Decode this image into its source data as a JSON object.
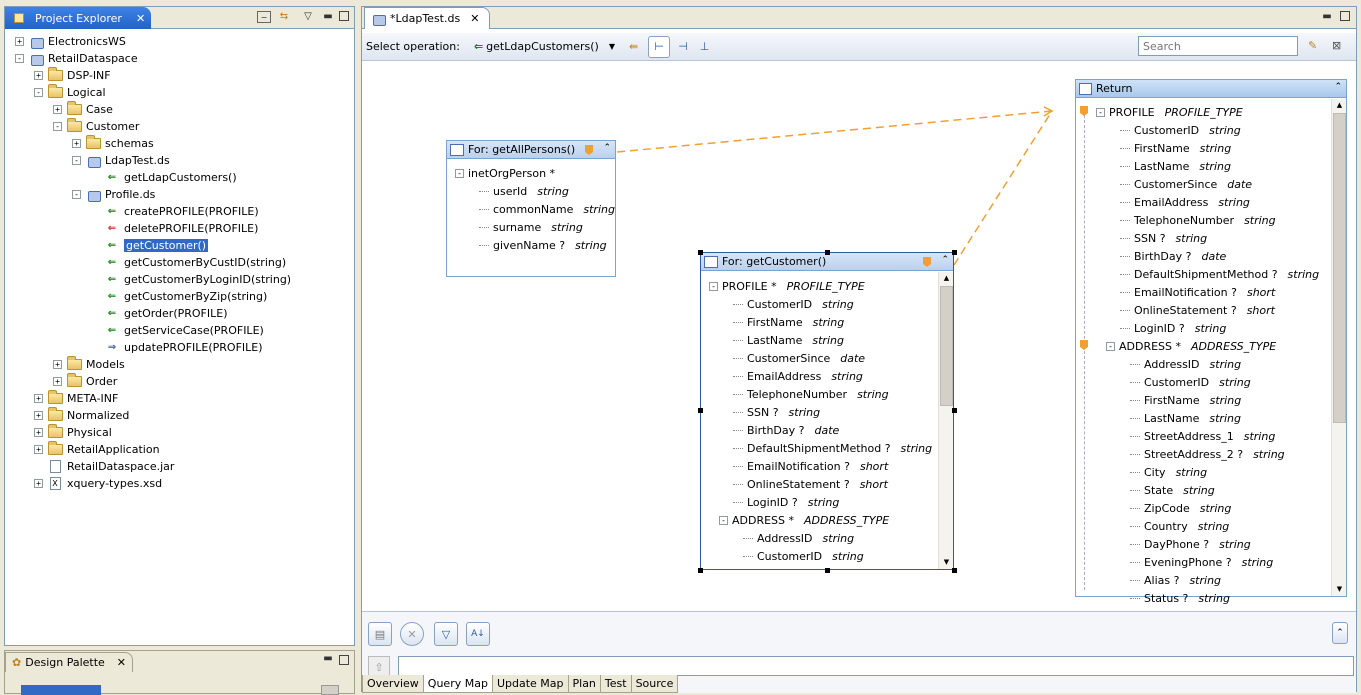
{
  "project_explorer": {
    "tab_label": "Project Explorer",
    "tree": [
      {
        "label": "ElectronicsWS",
        "kind": "ds-project",
        "expander": "+",
        "depth": 0
      },
      {
        "label": "RetailDataspace",
        "kind": "ds-project",
        "expander": "-",
        "depth": 0
      },
      {
        "label": "DSP-INF",
        "kind": "folder",
        "expander": "+",
        "depth": 1
      },
      {
        "label": "Logical",
        "kind": "folder",
        "expander": "-",
        "depth": 1
      },
      {
        "label": "Case",
        "kind": "folder",
        "expander": "+",
        "depth": 2
      },
      {
        "label": "Customer",
        "kind": "folder",
        "expander": "-",
        "depth": 2
      },
      {
        "label": "schemas",
        "kind": "folder",
        "expander": "+",
        "depth": 3
      },
      {
        "label": "LdapTest.ds",
        "kind": "ds",
        "expander": "-",
        "depth": 3
      },
      {
        "label": "getLdapCustomers()",
        "kind": "op",
        "expander": "",
        "depth": 4
      },
      {
        "label": "Profile.ds",
        "kind": "ds",
        "expander": "-",
        "depth": 3
      },
      {
        "label": "createPROFILE(PROFILE)",
        "kind": "op-create",
        "expander": "",
        "depth": 4
      },
      {
        "label": "deletePROFILE(PROFILE)",
        "kind": "op-delete",
        "expander": "",
        "depth": 4
      },
      {
        "label": "getCustomer()",
        "kind": "op",
        "expander": "",
        "depth": 4,
        "selected": true
      },
      {
        "label": "getCustomerByCustID(string)",
        "kind": "op",
        "expander": "",
        "depth": 4
      },
      {
        "label": "getCustomerByLoginID(string)",
        "kind": "op",
        "expander": "",
        "depth": 4
      },
      {
        "label": "getCustomerByZip(string)",
        "kind": "op",
        "expander": "",
        "depth": 4
      },
      {
        "label": "getOrder(PROFILE)",
        "kind": "op-nav",
        "expander": "",
        "depth": 4
      },
      {
        "label": "getServiceCase(PROFILE)",
        "kind": "op-nav",
        "expander": "",
        "depth": 4
      },
      {
        "label": "updatePROFILE(PROFILE)",
        "kind": "op-update",
        "expander": "",
        "depth": 4
      },
      {
        "label": "Models",
        "kind": "folder",
        "expander": "+",
        "depth": 2
      },
      {
        "label": "Order",
        "kind": "folder",
        "expander": "+",
        "depth": 2
      },
      {
        "label": "META-INF",
        "kind": "folder",
        "expander": "+",
        "depth": 1
      },
      {
        "label": "Normalized",
        "kind": "folder",
        "expander": "+",
        "depth": 1
      },
      {
        "label": "Physical",
        "kind": "folder",
        "expander": "+",
        "depth": 1
      },
      {
        "label": "RetailApplication",
        "kind": "folder",
        "expander": "+",
        "depth": 1
      },
      {
        "label": "RetailDataspace.jar",
        "kind": "file",
        "expander": "",
        "depth": 1
      },
      {
        "label": "xquery-types.xsd",
        "kind": "xsd",
        "expander": "+",
        "depth": 1
      }
    ]
  },
  "design_palette": {
    "tab_label": "Design Palette"
  },
  "editor": {
    "tab_label": "*LdapTest.ds",
    "toolbar": {
      "select_label": "Select operation:",
      "operation": "getLdapCustomers()",
      "search_placeholder": "Search"
    },
    "boxes": {
      "all_persons": {
        "title": "For: getAllPersons()",
        "rows": [
          {
            "name": "inetOrgPerson *",
            "type": "",
            "level": 0,
            "expander": "-"
          },
          {
            "name": "userId",
            "type": "string",
            "level": 1
          },
          {
            "name": "commonName",
            "type": "string",
            "level": 1
          },
          {
            "name": "surname",
            "type": "string",
            "level": 1
          },
          {
            "name": "givenName ?",
            "type": "string",
            "level": 1
          }
        ]
      },
      "get_customer": {
        "title": "For: getCustomer()",
        "rows": [
          {
            "name": "PROFILE *",
            "type": "PROFILE_TYPE",
            "level": 0,
            "expander": "-"
          },
          {
            "name": "CustomerID",
            "type": "string",
            "level": 1
          },
          {
            "name": "FirstName",
            "type": "string",
            "level": 1
          },
          {
            "name": "LastName",
            "type": "string",
            "level": 1
          },
          {
            "name": "CustomerSince",
            "type": "date",
            "level": 1
          },
          {
            "name": "EmailAddress",
            "type": "string",
            "level": 1
          },
          {
            "name": "TelephoneNumber",
            "type": "string",
            "level": 1
          },
          {
            "name": "SSN ?",
            "type": "string",
            "level": 1
          },
          {
            "name": "BirthDay ?",
            "type": "date",
            "level": 1
          },
          {
            "name": "DefaultShipmentMethod ?",
            "type": "string",
            "level": 1
          },
          {
            "name": "EmailNotification ?",
            "type": "short",
            "level": 1
          },
          {
            "name": "OnlineStatement ?",
            "type": "short",
            "level": 1
          },
          {
            "name": "LoginID ?",
            "type": "string",
            "level": 1
          },
          {
            "name": "ADDRESS *",
            "type": "ADDRESS_TYPE",
            "level": 1,
            "expander": "-"
          },
          {
            "name": "AddressID",
            "type": "string",
            "level": 2
          },
          {
            "name": "CustomerID",
            "type": "string",
            "level": 2
          }
        ]
      },
      "return": {
        "title": "Return",
        "rows": [
          {
            "name": "PROFILE",
            "type": "PROFILE_TYPE",
            "level": 0,
            "expander": "-"
          },
          {
            "name": "CustomerID",
            "type": "string",
            "level": 1
          },
          {
            "name": "FirstName",
            "type": "string",
            "level": 1
          },
          {
            "name": "LastName",
            "type": "string",
            "level": 1
          },
          {
            "name": "CustomerSince",
            "type": "date",
            "level": 1
          },
          {
            "name": "EmailAddress",
            "type": "string",
            "level": 1
          },
          {
            "name": "TelephoneNumber",
            "type": "string",
            "level": 1
          },
          {
            "name": "SSN ?",
            "type": "string",
            "level": 1
          },
          {
            "name": "BirthDay ?",
            "type": "date",
            "level": 1
          },
          {
            "name": "DefaultShipmentMethod ?",
            "type": "string",
            "level": 1
          },
          {
            "name": "EmailNotification ?",
            "type": "short",
            "level": 1
          },
          {
            "name": "OnlineStatement ?",
            "type": "short",
            "level": 1
          },
          {
            "name": "LoginID ?",
            "type": "string",
            "level": 1
          },
          {
            "name": "ADDRESS *",
            "type": "ADDRESS_TYPE",
            "level": 1,
            "expander": "-"
          },
          {
            "name": "AddressID",
            "type": "string",
            "level": 2
          },
          {
            "name": "CustomerID",
            "type": "string",
            "level": 2
          },
          {
            "name": "FirstName",
            "type": "string",
            "level": 2
          },
          {
            "name": "LastName",
            "type": "string",
            "level": 2
          },
          {
            "name": "StreetAddress_1",
            "type": "string",
            "level": 2
          },
          {
            "name": "StreetAddress_2 ?",
            "type": "string",
            "level": 2
          },
          {
            "name": "City",
            "type": "string",
            "level": 2
          },
          {
            "name": "State",
            "type": "string",
            "level": 2
          },
          {
            "name": "ZipCode",
            "type": "string",
            "level": 2
          },
          {
            "name": "Country",
            "type": "string",
            "level": 2
          },
          {
            "name": "DayPhone ?",
            "type": "string",
            "level": 2
          },
          {
            "name": "EveningPhone ?",
            "type": "string",
            "level": 2
          },
          {
            "name": "Alias ?",
            "type": "string",
            "level": 2
          },
          {
            "name": "Status ?",
            "type": "string",
            "level": 2
          }
        ]
      }
    },
    "bottom_tabs": [
      "Overview",
      "Query Map",
      "Update Map",
      "Plan",
      "Test",
      "Source"
    ],
    "active_bottom_tab": "Query Map"
  },
  "colors": {
    "selection": "#316ac5",
    "link": "#f0a030",
    "accent": "#3d83e5"
  }
}
